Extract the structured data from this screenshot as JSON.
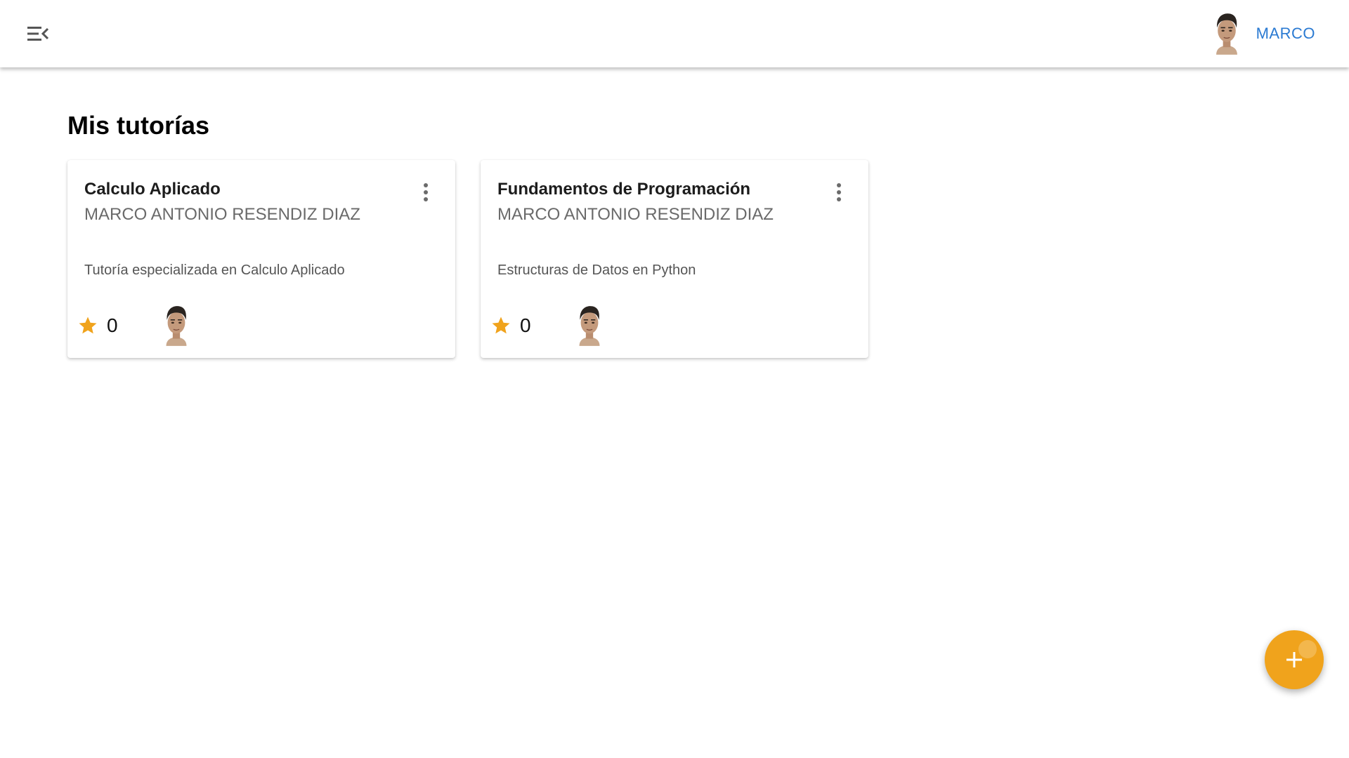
{
  "header": {
    "menu_icon": "menu-collapse-icon",
    "user_name": "MARCO"
  },
  "main": {
    "title": "Mis tutorías",
    "cards": [
      {
        "title": "Calculo Aplicado",
        "owner": "MARCO ANTONIO RESENDIZ DIAZ",
        "description": "Tutoría especializada en Calculo Aplicado",
        "rating": "0"
      },
      {
        "title": "Fundamentos de Programación",
        "owner": "MARCO ANTONIO RESENDIZ DIAZ",
        "description": "Estructuras de Datos en Python",
        "rating": "0"
      }
    ]
  },
  "fab": {
    "icon": "plus-icon"
  },
  "colors": {
    "accent": "#f0a31c",
    "user_link": "#2a7ad2",
    "star": "#f0a31c"
  }
}
